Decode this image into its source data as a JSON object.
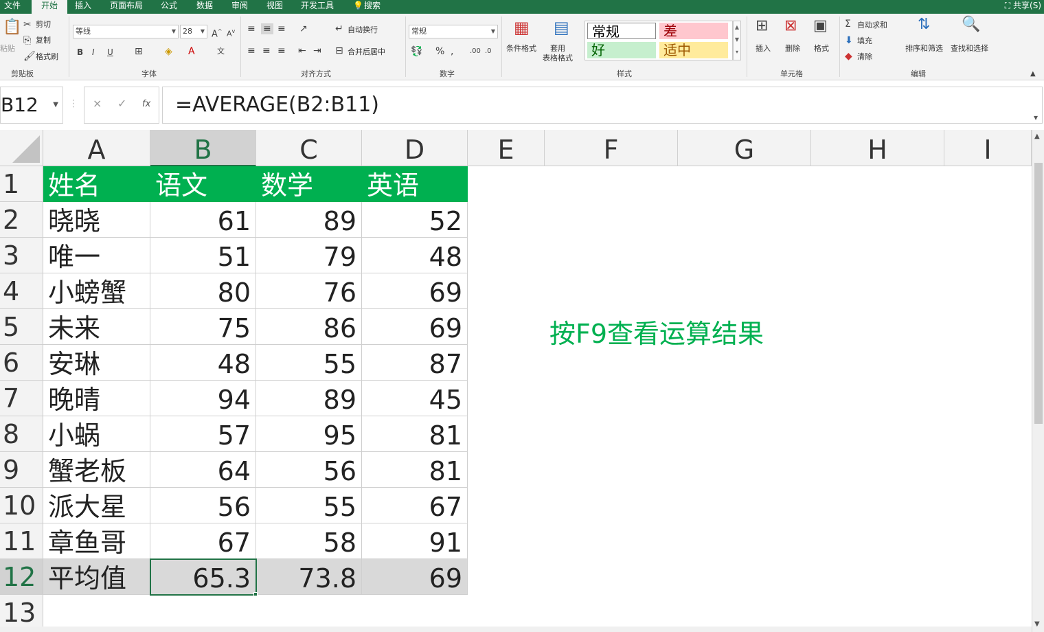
{
  "tabs": [
    "文件",
    "开始",
    "插入",
    "页面布局",
    "公式",
    "数据",
    "审阅",
    "视图",
    "开发工具",
    "搜索"
  ],
  "share": "共享(S)",
  "ribbon": {
    "clipboard": {
      "paste": "粘贴",
      "cut": "剪切",
      "copy": "复制",
      "format_painter": "格式刷",
      "label": "剪贴板"
    },
    "font": {
      "name": "等线",
      "size": "28",
      "bold": "B",
      "italic": "I",
      "underline": "U",
      "label": "字体"
    },
    "alignment": {
      "wrap": "自动换行",
      "merge": "合并后居中",
      "label": "对齐方式"
    },
    "number": {
      "format": "常规",
      "label": "数字"
    },
    "styles": {
      "conditional": "条件格式",
      "table_format": "套用\n表格格式",
      "cells": [
        {
          "text": "常规",
          "bg": "#ffffff",
          "fg": "#000000"
        },
        {
          "text": "差",
          "bg": "#ffc7ce",
          "fg": "#9c0006"
        },
        {
          "text": "好",
          "bg": "#c6efce",
          "fg": "#006100"
        },
        {
          "text": "适中",
          "bg": "#ffeb9c",
          "fg": "#9c5700"
        }
      ],
      "label": "样式"
    },
    "cells": {
      "insert": "插入",
      "delete": "删除",
      "format": "格式",
      "label": "单元格"
    },
    "editing": {
      "autosum": "自动求和",
      "fill": "填充",
      "clear": "清除",
      "sort": "排序和筛选",
      "find": "查找和选择",
      "label": "编辑"
    }
  },
  "formula_bar": {
    "name_box": "B12",
    "formula": "=AVERAGE(B2:B11)",
    "cancel": "×",
    "enter": "✓",
    "fx": "fx"
  },
  "columns": [
    "A",
    "B",
    "C",
    "D",
    "E",
    "F",
    "G",
    "H",
    "I"
  ],
  "rows": [
    "1",
    "2",
    "3",
    "4",
    "5",
    "6",
    "7",
    "8",
    "9",
    "10",
    "11",
    "12",
    "13"
  ],
  "table": {
    "headers": [
      "姓名",
      "语文",
      "数学",
      "英语"
    ],
    "data": [
      [
        "晓晓",
        "61",
        "89",
        "52"
      ],
      [
        "唯一",
        "51",
        "79",
        "48"
      ],
      [
        "小螃蟹",
        "80",
        "76",
        "69"
      ],
      [
        "未来",
        "75",
        "86",
        "69"
      ],
      [
        "安琳",
        "48",
        "55",
        "87"
      ],
      [
        "晚晴",
        "94",
        "89",
        "45"
      ],
      [
        "小蜗",
        "57",
        "95",
        "81"
      ],
      [
        "蟹老板",
        "64",
        "56",
        "81"
      ],
      [
        "派大星",
        "56",
        "55",
        "67"
      ],
      [
        "章鱼哥",
        "67",
        "58",
        "91"
      ]
    ],
    "average": [
      "平均值",
      "65.3",
      "73.8",
      "69"
    ]
  },
  "note": "按F9查看运算结果",
  "colors": {
    "accent": "#217346",
    "header_fill": "#00b050",
    "note": "#00b050",
    "avg_fill": "#d9d9d9"
  }
}
